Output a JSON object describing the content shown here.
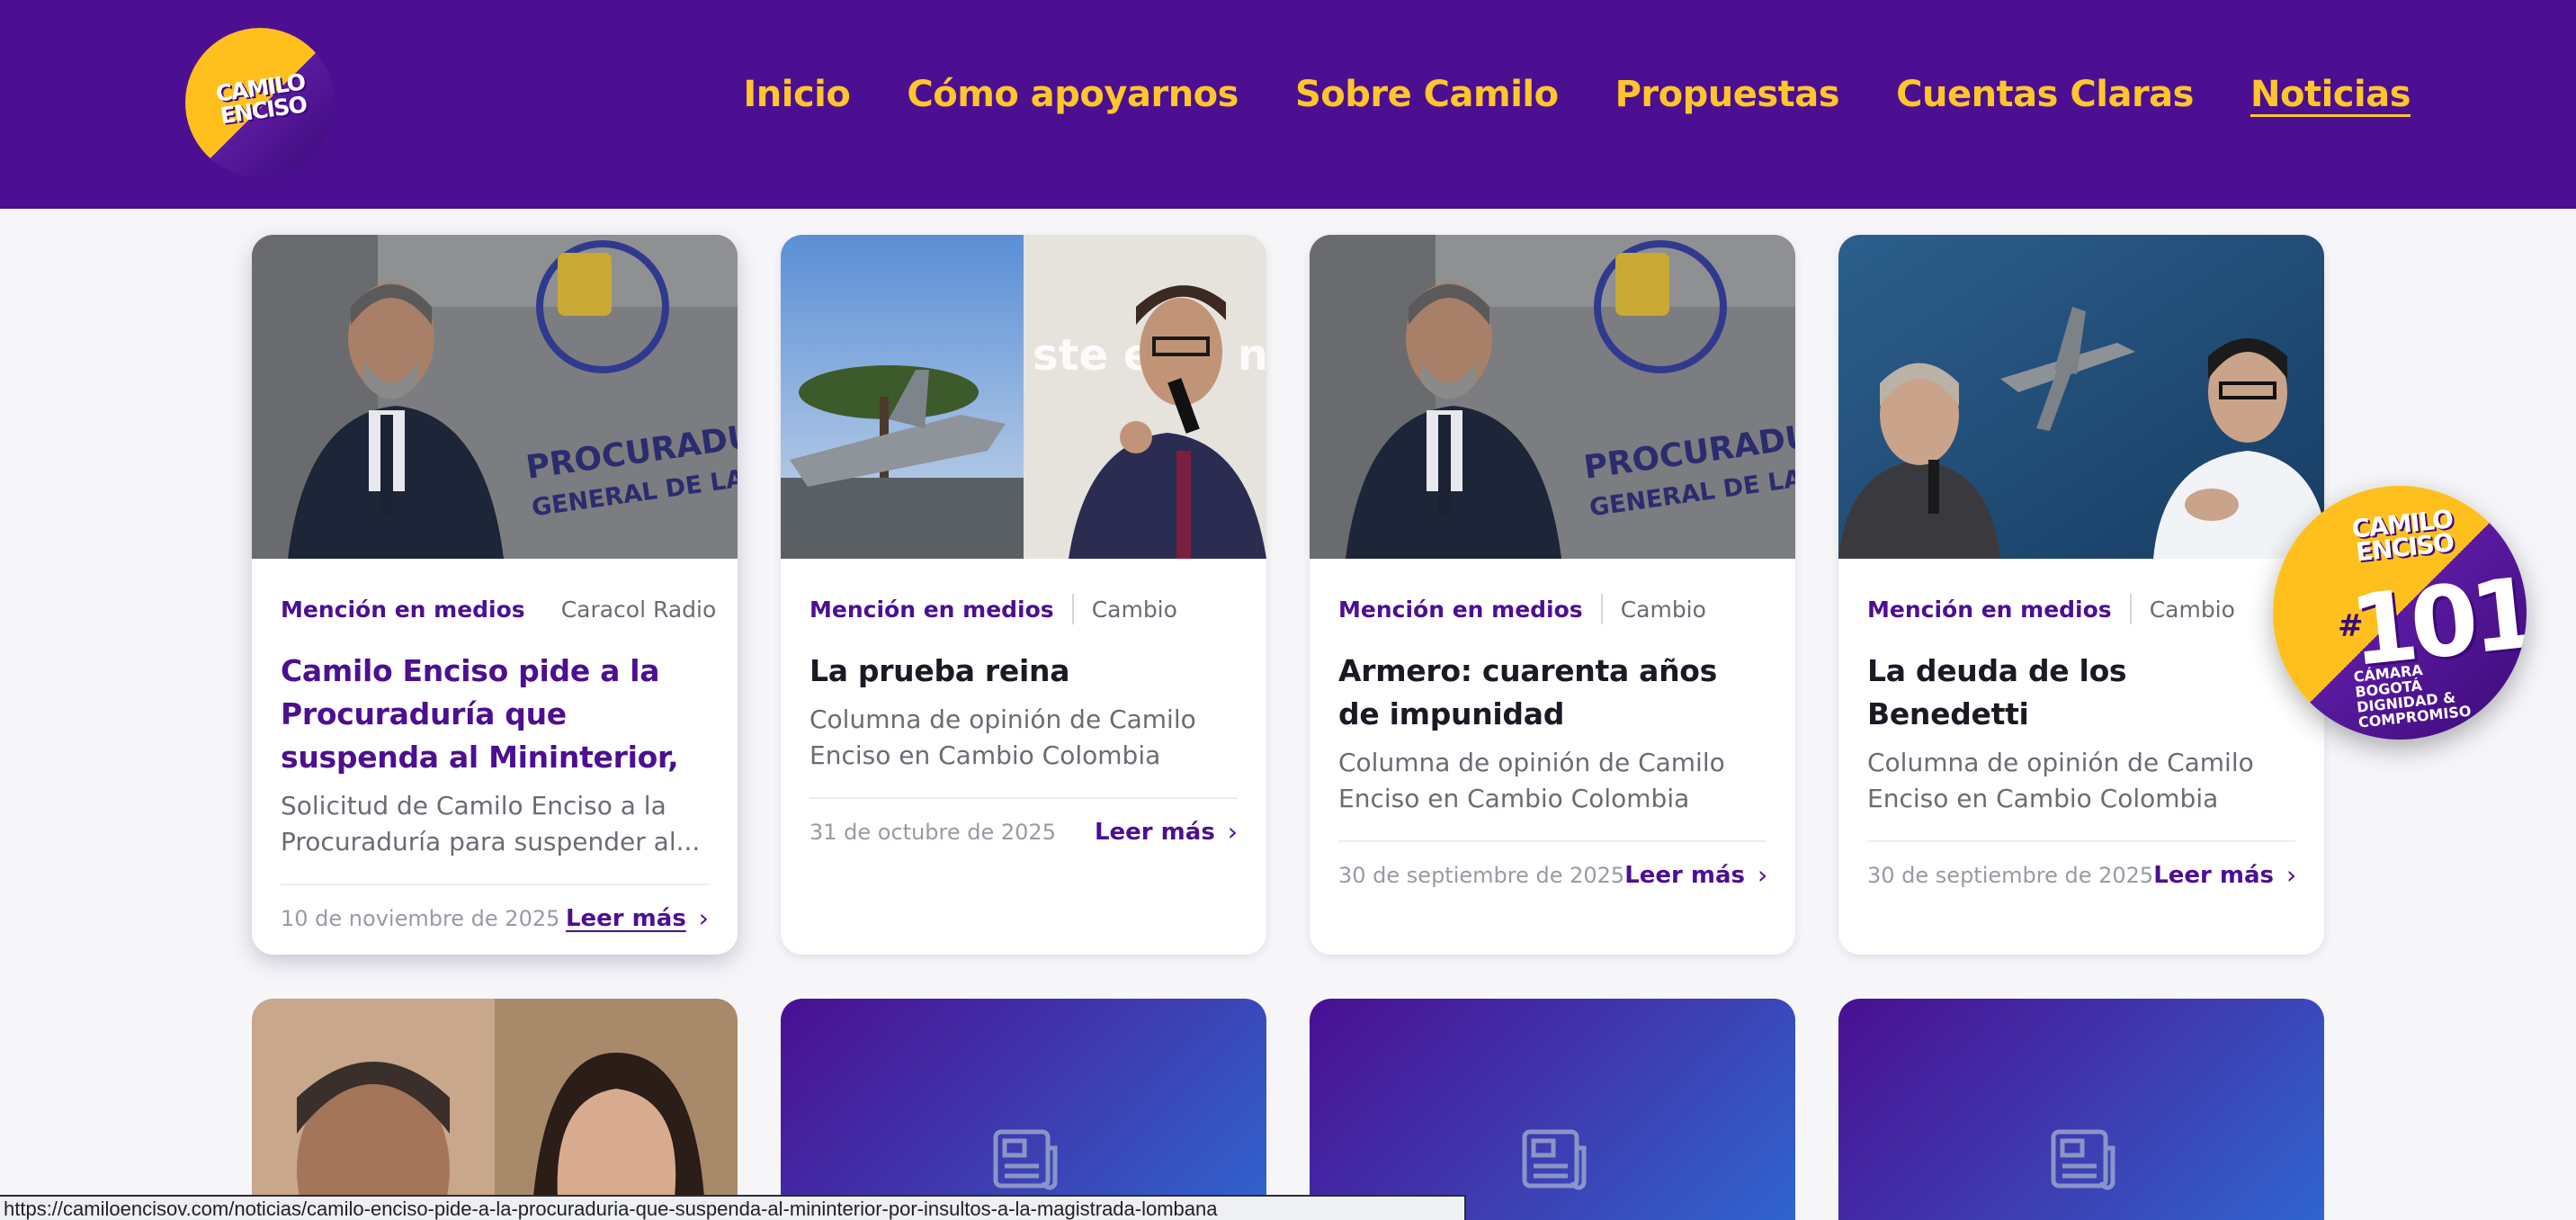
{
  "header": {
    "logo_text": "CAMILO ENCISO",
    "nav": [
      {
        "label": "Inicio"
      },
      {
        "label": "Cómo apoyarnos"
      },
      {
        "label": "Sobre Camilo"
      },
      {
        "label": "Propuestas"
      },
      {
        "label": "Cuentas Claras"
      },
      {
        "label": "Noticias",
        "active": true
      }
    ]
  },
  "cards": [
    {
      "category": "Mención en medios",
      "source": "Caracol Radio",
      "title": "Camilo Enciso pide a la Procuraduría que suspenda al Mininterior, por insultos ...",
      "description": "Solicitud de Camilo Enciso a la Procuraduría para suspender al...",
      "date": "10 de noviembre de 2025",
      "read_more": "Leer más"
    },
    {
      "category": "Mención en medios",
      "source": "Cambio",
      "title": "La prueba reina",
      "description": "Columna de opinión de Camilo Enciso en Cambio Colombia",
      "date": "31 de octubre de 2025",
      "read_more": "Leer más",
      "image_text": "ste es e na rru"
    },
    {
      "category": "Mención en medios",
      "source": "Cambio",
      "title": "Armero: cuarenta años de impunidad",
      "description": "Columna de opinión de Camilo Enciso en Cambio Colombia",
      "date": "30 de septiembre de 2025",
      "read_more": "Leer más"
    },
    {
      "category": "Mención en medios",
      "source": "Cambio",
      "title": "La deuda de los Benedetti",
      "description": "Columna de opinión de Camilo Enciso en Cambio Colombia",
      "date": "30 de septiembre de 2025",
      "read_more": "Leer más"
    }
  ],
  "wall_text": [
    "PROCURADURIA",
    "GENERAL DE LA NACION"
  ],
  "badge": {
    "name": "CAMILO ENCISO",
    "hash": "#",
    "number": "101",
    "subtitle": "CÁMARA BOGOTÁ DIGNIDAD & COMPROMISO"
  },
  "status_url": "https://camiloencisov.com/noticias/camilo-enciso-pide-a-la-procuraduria-que-suspenda-al-mininterior-por-insultos-a-la-magistrada-lombana",
  "colors": {
    "header_bg": "#4d0f91",
    "nav_text": "#ffc62b",
    "accent": "#4d0f91",
    "page_bg": "#f6f6f9"
  }
}
